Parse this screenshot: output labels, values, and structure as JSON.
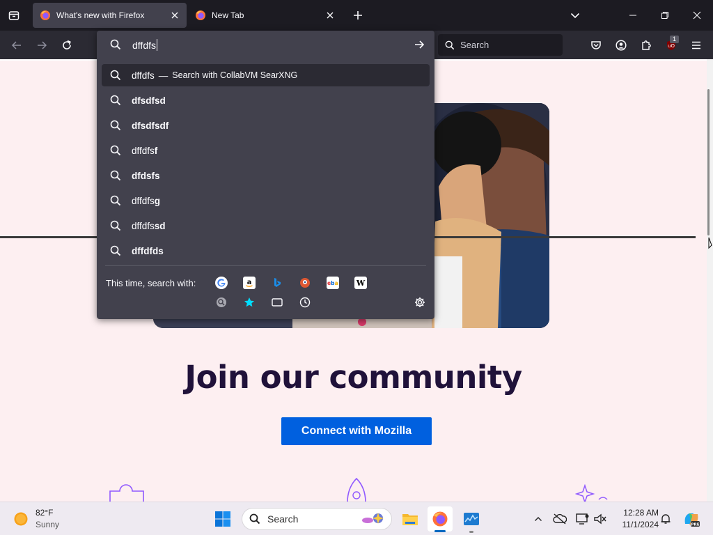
{
  "browser": {
    "tabs": [
      {
        "title": "What's new with Firefox",
        "active": true
      },
      {
        "title": "New Tab",
        "active": false
      }
    ],
    "url_input_value": "dffdfs",
    "search_placeholder": "Search",
    "extension_badge": "1"
  },
  "dropdown": {
    "primary": {
      "text": "dffdfs",
      "separator": "—",
      "action": "Search with CollabVM SearXNG"
    },
    "suggestions": [
      {
        "prefix": "",
        "bold": "dfsdfsd"
      },
      {
        "prefix": "",
        "bold": "dfsdfsdf"
      },
      {
        "prefix": "dffdfs",
        "bold": "f"
      },
      {
        "prefix": "",
        "bold": "dfdsfs"
      },
      {
        "prefix": "dffdfs",
        "bold": "g"
      },
      {
        "prefix": "dffdfs",
        "bold": "sd"
      },
      {
        "prefix": "",
        "bold": "dffdfds"
      }
    ],
    "search_with_label": "This time, search with:",
    "engines": [
      "google-icon",
      "amazon-icon",
      "bing-icon",
      "duckduckgo-icon",
      "ebay-icon",
      "wikipedia-icon",
      "searxng-icon",
      "bookmarks-icon",
      "tabs-icon",
      "history-icon"
    ]
  },
  "page": {
    "heading": "Join our community",
    "button": "Connect with Mozilla"
  },
  "taskbar": {
    "weather_temp": "82°F",
    "weather_condition": "Sunny",
    "search_label": "Search",
    "time": "12:28 AM",
    "date": "11/1/2024"
  },
  "colors": {
    "accent": "#0060df",
    "panel": "#42414d",
    "page_bg": "#fdeff1",
    "heading": "#20123a"
  }
}
